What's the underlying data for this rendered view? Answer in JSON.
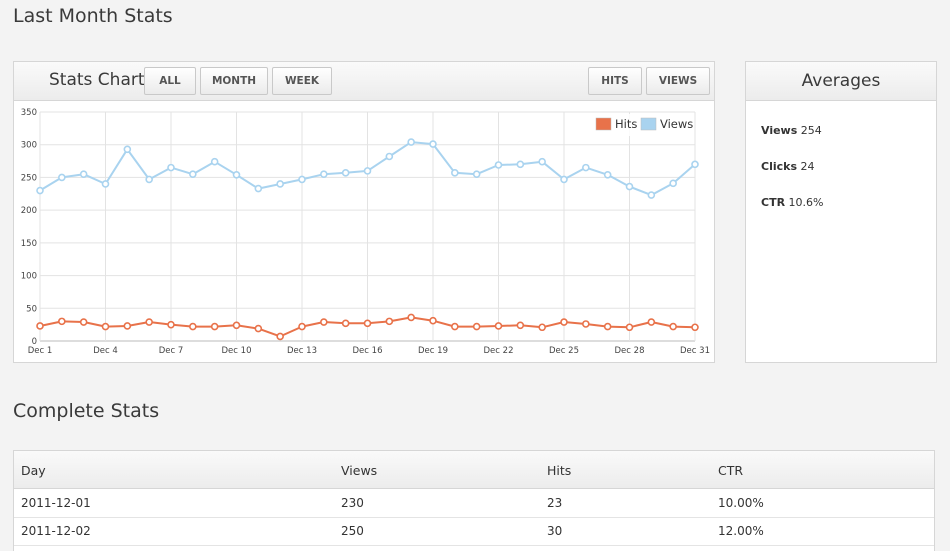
{
  "page": {
    "title": "Last Month Stats",
    "complete_title": "Complete Stats"
  },
  "chart_panel": {
    "title": "Stats Chart",
    "buttons": {
      "all": "ALL",
      "month": "MONTH",
      "week": "WEEK",
      "hits": "HITS",
      "views": "VIEWS"
    }
  },
  "averages": {
    "title": "Averages",
    "views_label": "Views",
    "views_value": "254",
    "clicks_label": "Clicks",
    "clicks_value": "24",
    "ctr_label": "CTR",
    "ctr_value": "10.6%"
  },
  "table": {
    "headers": [
      "Day",
      "Views",
      "Hits",
      "CTR"
    ],
    "rows": [
      [
        "2011-12-01",
        "230",
        "23",
        "10.00%"
      ],
      [
        "2011-12-02",
        "250",
        "30",
        "12.00%"
      ]
    ]
  },
  "colors": {
    "hits": "#e8724a",
    "views": "#a9d3ef"
  },
  "chart_data": {
    "type": "line",
    "x": [
      "Dec 1",
      "Dec 2",
      "Dec 3",
      "Dec 4",
      "Dec 5",
      "Dec 6",
      "Dec 7",
      "Dec 8",
      "Dec 9",
      "Dec 10",
      "Dec 11",
      "Dec 12",
      "Dec 13",
      "Dec 14",
      "Dec 15",
      "Dec 16",
      "Dec 17",
      "Dec 18",
      "Dec 19",
      "Dec 20",
      "Dec 21",
      "Dec 22",
      "Dec 23",
      "Dec 24",
      "Dec 25",
      "Dec 26",
      "Dec 27",
      "Dec 28",
      "Dec 29",
      "Dec 30",
      "Dec 31"
    ],
    "x_tick_labels": [
      "Dec 1",
      "Dec 4",
      "Dec 7",
      "Dec 10",
      "Dec 13",
      "Dec 16",
      "Dec 19",
      "Dec 22",
      "Dec 25",
      "Dec 28",
      "Dec 31"
    ],
    "series": [
      {
        "name": "Hits",
        "color": "#e8724a",
        "values": [
          23,
          30,
          29,
          22,
          23,
          29,
          25,
          22,
          22,
          24,
          19,
          7,
          22,
          29,
          27,
          27,
          30,
          36,
          31,
          22,
          22,
          23,
          24,
          21,
          29,
          26,
          22,
          21,
          29,
          22,
          21
        ]
      },
      {
        "name": "Views",
        "color": "#a9d3ef",
        "values": [
          230,
          250,
          255,
          240,
          293,
          247,
          265,
          255,
          274,
          254,
          233,
          240,
          247,
          255,
          257,
          260,
          282,
          304,
          301,
          257,
          255,
          269,
          270,
          274,
          247,
          265,
          254,
          236,
          223,
          241,
          270
        ]
      }
    ],
    "ylim": [
      0,
      350
    ],
    "y_ticks": [
      0,
      50,
      100,
      150,
      200,
      250,
      300,
      350
    ],
    "grid": true,
    "legend": "top-right"
  }
}
